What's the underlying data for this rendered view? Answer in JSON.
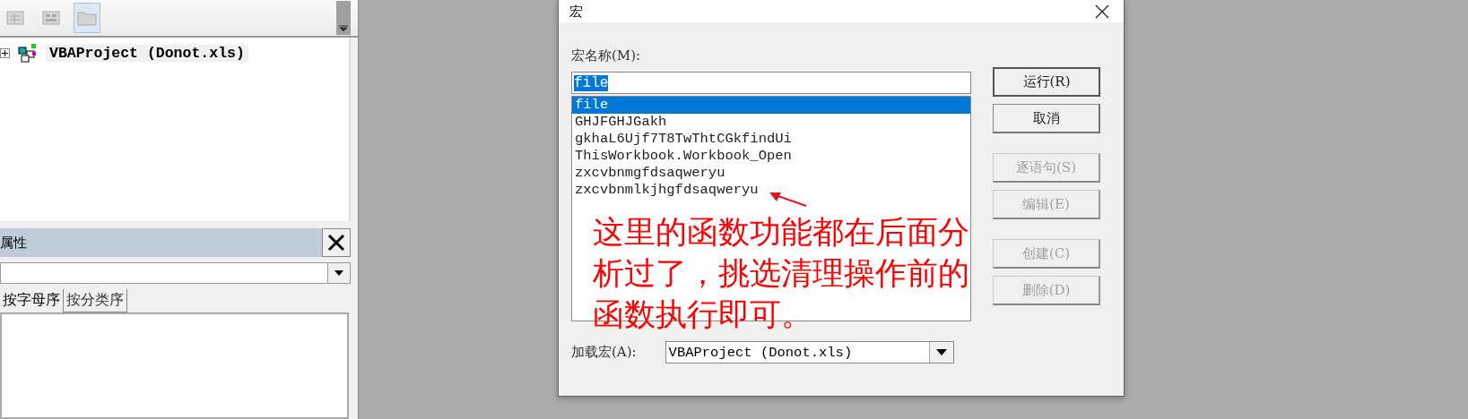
{
  "project_explorer": {
    "toolbar": [
      {
        "kind": "grid",
        "selected": false
      },
      {
        "kind": "form",
        "selected": false
      },
      {
        "kind": "folder",
        "selected": true
      }
    ],
    "tree": [
      {
        "label": "VBAProject (Donot.xls)",
        "expanded": false
      }
    ]
  },
  "properties": {
    "title": "属性",
    "tabs": [
      {
        "label": "按字母序",
        "selected": true
      },
      {
        "label": "按分类序",
        "selected": false
      }
    ]
  },
  "dialog": {
    "title": "宏",
    "name_label": "宏名称(M):",
    "name_value": "file",
    "macros": [
      {
        "label": "file",
        "selected": true
      },
      {
        "label": "GHJFGHJGakh",
        "selected": false
      },
      {
        "label": "gkhaL6Ujf7T8TwThtCGkfindUi",
        "selected": false
      },
      {
        "label": "ThisWorkbook.Workbook_Open",
        "selected": false
      },
      {
        "label": "zxcvbnmgfdsaqweryu",
        "selected": false
      },
      {
        "label": "zxcvbnmlkjhgfdsaqweryu",
        "selected": false
      }
    ],
    "buttons": [
      {
        "label": "运行(R)",
        "disabled": false,
        "default": true
      },
      {
        "label": "取消",
        "disabled": false,
        "default": false
      },
      {
        "label": "逐语句(S)",
        "disabled": true,
        "default": false
      },
      {
        "label": "编辑(E)",
        "disabled": true,
        "default": false
      },
      {
        "label": "创建(C)",
        "disabled": true,
        "default": false
      },
      {
        "label": "删除(D)",
        "disabled": true,
        "default": false
      }
    ],
    "location_label": "加载宏(A):",
    "location_value": "VBAProject (Donot.xls)"
  },
  "annotation": "这里的函数功能都在后面分析过了，挑选清理操作前的函数执行即可。"
}
